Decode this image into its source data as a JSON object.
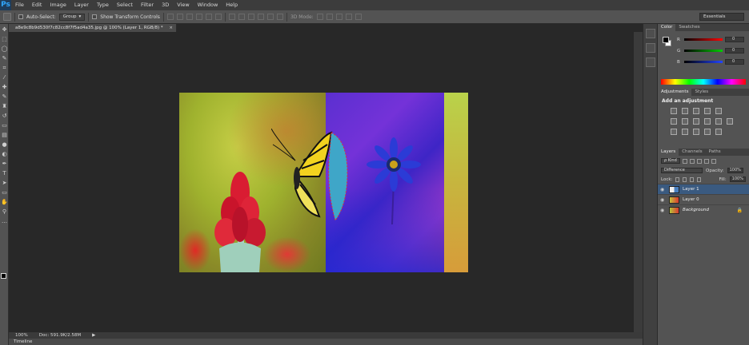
{
  "app": {
    "logo": "Ps"
  },
  "menu": [
    "File",
    "Edit",
    "Image",
    "Layer",
    "Type",
    "Select",
    "Filter",
    "3D",
    "View",
    "Window",
    "Help"
  ],
  "options_bar": {
    "auto_select_label": "Auto-Select:",
    "auto_select_value": "Group",
    "show_transform_label": "Show Transform Controls",
    "mode_3d_label": "3D Mode:",
    "workspace": "Essentials"
  },
  "document_tab": {
    "title": "a8e9c8b9d530f7c82cc8f7f5ad4a35.jpg @ 100% (Layer 1, RGB/8) *",
    "close": "×"
  },
  "status_bar": {
    "zoom": "100%",
    "doc_info": "Doc: 591.9K/2.58M",
    "arrow": "▶"
  },
  "timeline": {
    "label": "Timeline"
  },
  "color_panel": {
    "tabs": [
      "Color",
      "Swatches"
    ],
    "sliders": [
      {
        "label": "R",
        "value": "0",
        "color": "#ff2020"
      },
      {
        "label": "G",
        "value": "0",
        "color": "#20c020"
      },
      {
        "label": "B",
        "value": "0",
        "color": "#2040ff"
      }
    ]
  },
  "adjustments_panel": {
    "tabs": [
      "Adjustments",
      "Styles"
    ],
    "title": "Add an adjustment"
  },
  "layers_panel": {
    "tabs": [
      "Layers",
      "Channels",
      "Paths"
    ],
    "filter_kind": "ρ Kind",
    "blend_mode": "Difference",
    "opacity_label": "Opacity:",
    "opacity_value": "100%",
    "lock_label": "Lock:",
    "fill_label": "Fill:",
    "fill_value": "100%",
    "layers": [
      {
        "name": "Layer 1",
        "selected": true,
        "locked": false
      },
      {
        "name": "Layer 0",
        "selected": false,
        "locked": false
      },
      {
        "name": "Background",
        "selected": false,
        "locked": true
      }
    ]
  },
  "icons": {
    "eye": "eye-icon",
    "lock": "lock-icon"
  }
}
